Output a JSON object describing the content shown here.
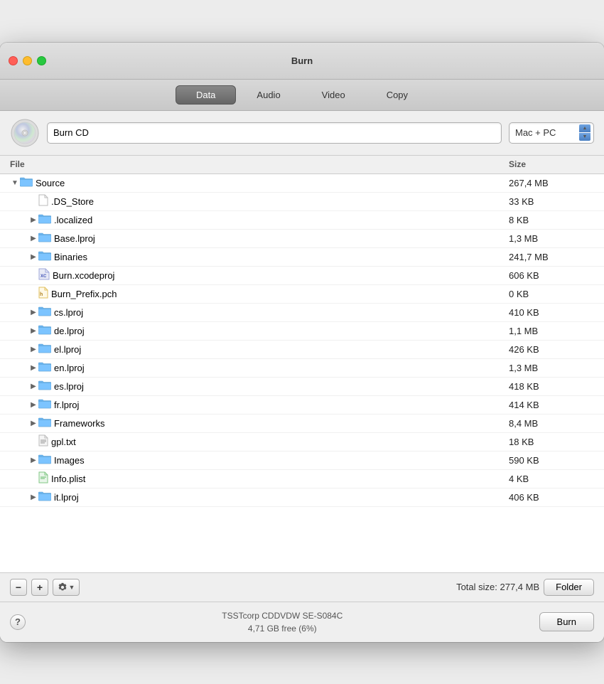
{
  "window": {
    "title": "Burn"
  },
  "tabs": [
    {
      "id": "data",
      "label": "Data",
      "active": true
    },
    {
      "id": "audio",
      "label": "Audio",
      "active": false
    },
    {
      "id": "video",
      "label": "Video",
      "active": false
    },
    {
      "id": "copy",
      "label": "Copy",
      "active": false
    }
  ],
  "toolbar": {
    "project_name": "Burn CD",
    "project_name_placeholder": "Burn CD",
    "format": "Mac + PC"
  },
  "file_list": {
    "col_file": "File",
    "col_size": "Size",
    "rows": [
      {
        "id": "source",
        "name": "Source",
        "size": "267,4 MB",
        "type": "folder",
        "indent": 0,
        "expanded": true,
        "expand": "▼"
      },
      {
        "id": "ds_store",
        "name": ".DS_Store",
        "size": "33 KB",
        "type": "file-plain",
        "indent": 1,
        "expanded": false,
        "expand": ""
      },
      {
        "id": "localized",
        "name": ".localized",
        "size": "8 KB",
        "type": "folder",
        "indent": 1,
        "expanded": false,
        "expand": "▶"
      },
      {
        "id": "base_lproj",
        "name": "Base.lproj",
        "size": "1,3 MB",
        "type": "folder",
        "indent": 1,
        "expanded": false,
        "expand": "▶"
      },
      {
        "id": "binaries",
        "name": "Binaries",
        "size": "241,7 MB",
        "type": "folder",
        "indent": 1,
        "expanded": false,
        "expand": "▶"
      },
      {
        "id": "burn_xcodeproj",
        "name": "Burn.xcodeproj",
        "size": "606 KB",
        "type": "file-xcode",
        "indent": 1,
        "expanded": false,
        "expand": ""
      },
      {
        "id": "burn_prefix_pch",
        "name": "Burn_Prefix.pch",
        "size": "0 KB",
        "type": "file-header",
        "indent": 1,
        "expanded": false,
        "expand": ""
      },
      {
        "id": "cs_lproj",
        "name": "cs.lproj",
        "size": "410 KB",
        "type": "folder",
        "indent": 1,
        "expanded": false,
        "expand": "▶"
      },
      {
        "id": "de_lproj",
        "name": "de.lproj",
        "size": "1,1 MB",
        "type": "folder",
        "indent": 1,
        "expanded": false,
        "expand": "▶"
      },
      {
        "id": "el_lproj",
        "name": "el.lproj",
        "size": "426 KB",
        "type": "folder",
        "indent": 1,
        "expanded": false,
        "expand": "▶"
      },
      {
        "id": "en_lproj",
        "name": "en.lproj",
        "size": "1,3 MB",
        "type": "folder",
        "indent": 1,
        "expanded": false,
        "expand": "▶"
      },
      {
        "id": "es_lproj",
        "name": "es.lproj",
        "size": "418 KB",
        "type": "folder",
        "indent": 1,
        "expanded": false,
        "expand": "▶"
      },
      {
        "id": "fr_lproj",
        "name": "fr.lproj",
        "size": "414 KB",
        "type": "folder",
        "indent": 1,
        "expanded": false,
        "expand": "▶"
      },
      {
        "id": "frameworks",
        "name": "Frameworks",
        "size": "8,4 MB",
        "type": "folder",
        "indent": 1,
        "expanded": false,
        "expand": "▶"
      },
      {
        "id": "gpl_txt",
        "name": "gpl.txt",
        "size": "18 KB",
        "type": "file-text",
        "indent": 1,
        "expanded": false,
        "expand": ""
      },
      {
        "id": "images",
        "name": "Images",
        "size": "590 KB",
        "type": "folder",
        "indent": 1,
        "expanded": false,
        "expand": "▶"
      },
      {
        "id": "info_plist",
        "name": "Info.plist",
        "size": "4 KB",
        "type": "file-plist",
        "indent": 1,
        "expanded": false,
        "expand": ""
      },
      {
        "id": "it_lproj",
        "name": "it.lproj",
        "size": "406 KB",
        "type": "folder",
        "indent": 1,
        "expanded": false,
        "expand": "▶"
      }
    ]
  },
  "bottom_toolbar": {
    "minus_label": "−",
    "plus_label": "+",
    "total_size_label": "Total size: 277,4 MB",
    "folder_btn_label": "Folder"
  },
  "statusbar": {
    "help_label": "?",
    "drive_name": "TSSTcorp CDDVDW SE-S084C",
    "drive_free": "4,71 GB free (6%)",
    "burn_label": "Burn"
  }
}
